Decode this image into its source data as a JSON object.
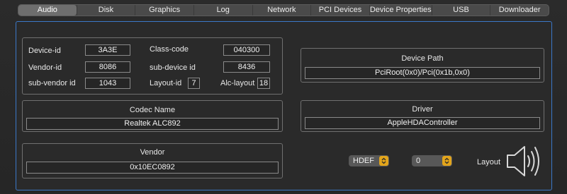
{
  "tabs": [
    {
      "label": "Audio",
      "active": true
    },
    {
      "label": "Disk"
    },
    {
      "label": "Graphics"
    },
    {
      "label": "Log"
    },
    {
      "label": "Network"
    },
    {
      "label": "PCI Devices"
    },
    {
      "label": "Device Properties"
    },
    {
      "label": "USB"
    },
    {
      "label": "Downloader"
    }
  ],
  "ids": {
    "device_id_label": "Device-id",
    "device_id_value": "3A3E",
    "vendor_id_label": "Vendor-id",
    "vendor_id_value": "8086",
    "subvendor_id_label": "sub-vendor id",
    "subvendor_id_value": "1043",
    "class_code_label": "Class-code",
    "class_code_value": "040300",
    "subdevice_id_label": "sub-device id",
    "subdevice_id_value": "8436",
    "layout_id_label": "Layout-id",
    "layout_id_value": "7",
    "alc_layout_label": "Alc-layout",
    "alc_layout_value": "18"
  },
  "device_path": {
    "title": "Device Path",
    "value": "PciRoot(0x0)/Pci(0x1b,0x0)"
  },
  "codec": {
    "title": "Codec Name",
    "value": "Realtek ALC892"
  },
  "driver": {
    "title": "Driver",
    "value": "AppleHDAController"
  },
  "vendor": {
    "title": "Vendor",
    "value": "0x10EC0892"
  },
  "controls": {
    "hdef_selected": "HDEF",
    "layout_selected": "0",
    "layout_label": "Layout",
    "accent_color": "#e3a51b"
  },
  "icons": {
    "speaker": "speaker-icon",
    "popup_arrows": "chevron-updown-icon"
  }
}
